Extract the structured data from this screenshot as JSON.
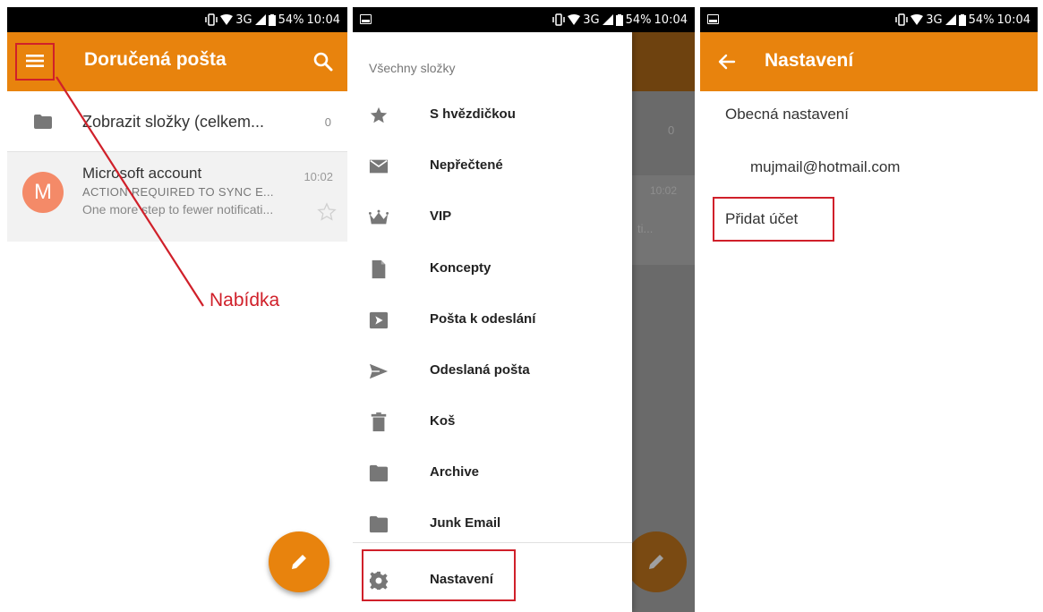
{
  "status": {
    "network": "3G",
    "battery": "54%",
    "time": "10:04"
  },
  "inbox": {
    "title": "Doručená pošta",
    "folders_label": "Zobrazit složky (celkem...",
    "folders_count": "0",
    "message": {
      "avatar_letter": "M",
      "sender": "Microsoft account",
      "time": "10:02",
      "subject": "ACTION REQUIRED TO SYNC E...",
      "preview": "One more step to fewer notificati..."
    },
    "annotation": "Nabídka"
  },
  "drawer": {
    "header": "Všechny složky",
    "items": [
      {
        "label": "S hvězdičkou",
        "icon": "star-icon"
      },
      {
        "label": "Nepřečtené",
        "icon": "envelope-icon"
      },
      {
        "label": "VIP",
        "icon": "crown-icon"
      },
      {
        "label": "Koncepty",
        "icon": "document-icon"
      },
      {
        "label": "Pošta k odeslání",
        "icon": "outbox-icon"
      },
      {
        "label": "Odeslaná pošta",
        "icon": "send-icon"
      },
      {
        "label": "Koš",
        "icon": "trash-icon"
      },
      {
        "label": "Archive",
        "icon": "folder-icon"
      },
      {
        "label": "Junk Email",
        "icon": "folder-icon"
      },
      {
        "label": "Nastavení",
        "icon": "gear-icon"
      }
    ],
    "behind": {
      "count": "0",
      "time": "10:02",
      "preview_fragment": "ti..."
    }
  },
  "settings": {
    "title": "Nastavení",
    "general": "Obecná nastavení",
    "account": "mujmail@hotmail.com",
    "add_account": "Přidat účet"
  },
  "colors": {
    "accent": "#e8830d",
    "highlight": "#d0202a",
    "avatar": "#f48a68"
  }
}
